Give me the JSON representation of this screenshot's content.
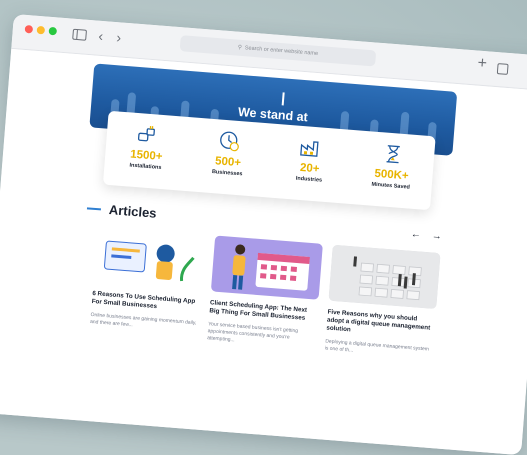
{
  "browser": {
    "address_placeholder": "Search or enter website name"
  },
  "hero": {
    "title": "We stand at"
  },
  "stats": [
    {
      "value": "1500+",
      "label": "Installations",
      "icon": "plug-hand-icon"
    },
    {
      "value": "500+",
      "label": "Businesses",
      "icon": "clock-dollar-icon"
    },
    {
      "value": "20+",
      "label": "Industries",
      "icon": "factory-icon"
    },
    {
      "value": "500K+",
      "label": "Minutes Saved",
      "icon": "hourglass-icon"
    }
  ],
  "articles": {
    "heading": "Articles",
    "cards": [
      {
        "title": "6 Reasons To Use Scheduling App For Small Businesses",
        "desc": "Online businesses are gaining momentum daily, and there are few..."
      },
      {
        "title": "Client Scheduling App: The Next Big Thing For Small Businesses",
        "desc": "Your service based business isn't getting appointments consistently and you're attempting..."
      },
      {
        "title": "Five Reasons why you should adopt a digital queue management solution",
        "desc": "Deploying a digital queue management system is one of th..."
      }
    ]
  },
  "colors": {
    "accent_yellow": "#e8b400",
    "hero_blue": "#1e5aa0",
    "link_blue": "#2f7fd1"
  }
}
